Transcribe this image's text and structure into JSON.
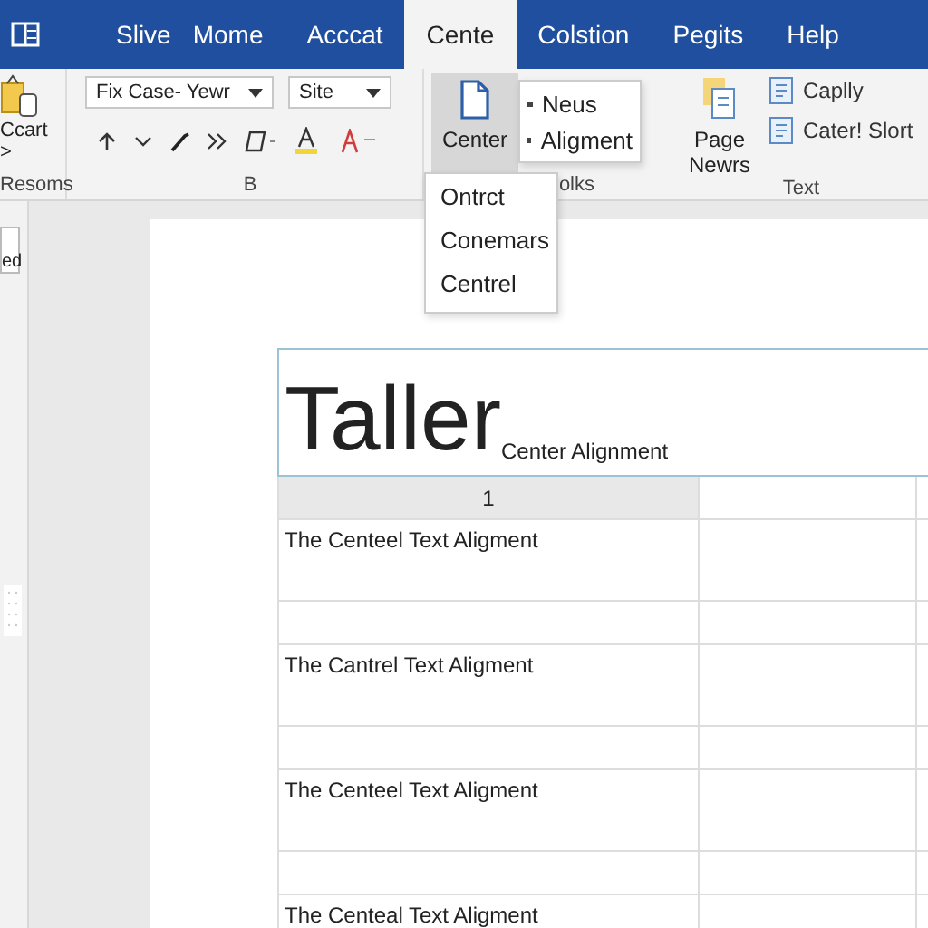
{
  "tabs": [
    {
      "label": "Slive",
      "selected": false
    },
    {
      "label": "Mome",
      "selected": false
    },
    {
      "label": "Acccat",
      "selected": false
    },
    {
      "label": "Cente",
      "selected": true
    },
    {
      "label": "Colstion",
      "selected": false
    },
    {
      "label": "Pegits",
      "selected": false
    },
    {
      "label": "Help",
      "selected": false
    }
  ],
  "ribbon": {
    "clipboard": {
      "button": "Ccart",
      "more": ">",
      "group_label": "Resoms"
    },
    "font": {
      "font_name": "Fix Case- Yewr",
      "font_size": "Site",
      "group_label": "B"
    },
    "center": {
      "button": "Center",
      "group_label": "olks"
    },
    "text": {
      "page_button": "Page Newrs",
      "items": [
        "Caplly",
        "Cater! Slort"
      ],
      "group_label": "Text"
    }
  },
  "side_menu": {
    "items": [
      "Neus",
      "Aligment"
    ]
  },
  "center_menu": {
    "items": [
      "Ontrct",
      "Conemars",
      "Centrel"
    ]
  },
  "left_panel": {
    "label": "ed"
  },
  "document": {
    "title": "Taller",
    "subtitle": "Center Alignment",
    "table": {
      "header": [
        "1"
      ],
      "rows": [
        {
          "kind": "text",
          "cells": [
            "The Centeel Text Aligment"
          ]
        },
        {
          "kind": "empty"
        },
        {
          "kind": "text",
          "cells": [
            "The Cantrel Text Aligment"
          ]
        },
        {
          "kind": "empty"
        },
        {
          "kind": "text",
          "cells": [
            "The Centeel Text Aligment"
          ]
        },
        {
          "kind": "empty"
        },
        {
          "kind": "text",
          "cells": [
            "The Centeal Text Aligment"
          ]
        }
      ]
    }
  }
}
